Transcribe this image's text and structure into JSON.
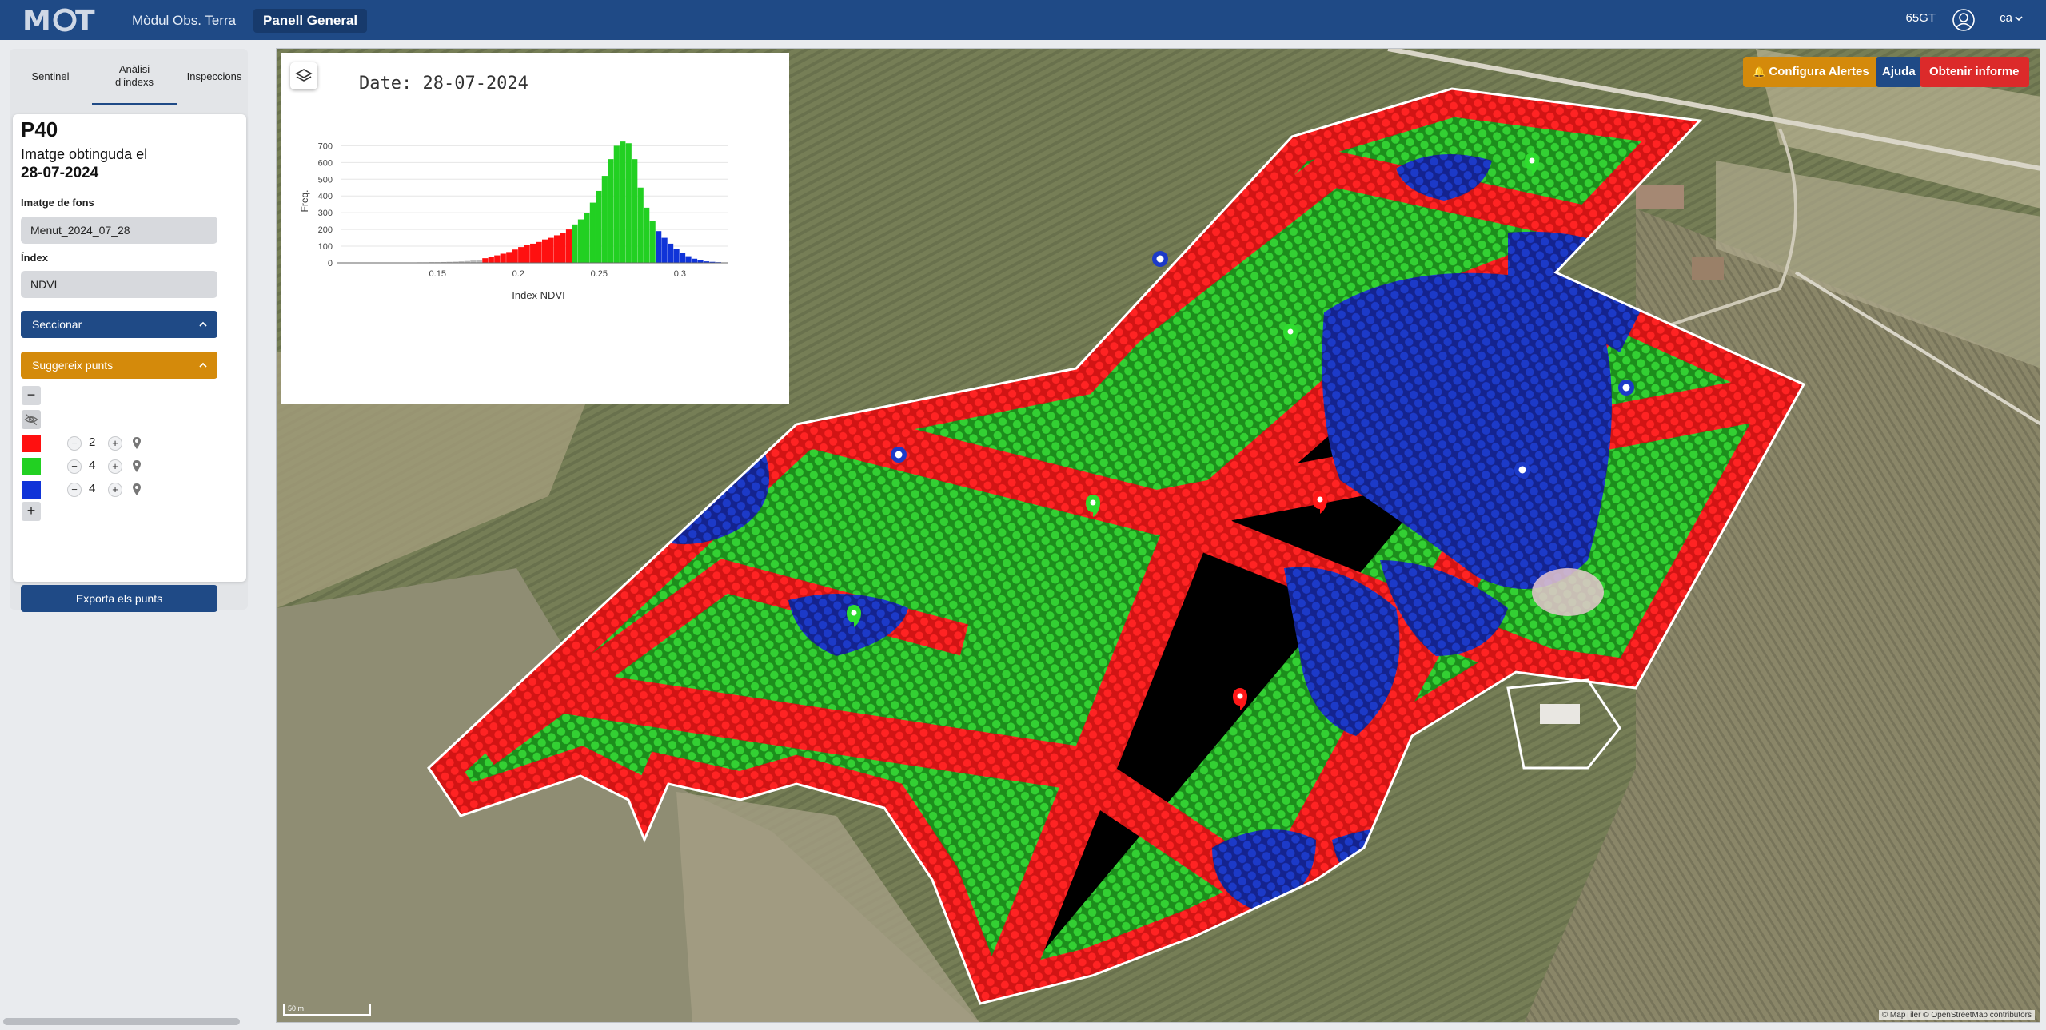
{
  "navbar": {
    "brand": "MOT",
    "links": [
      "Mòdul Obs. Terra",
      "Panell General"
    ],
    "active_link": "Panell General",
    "user": "65GT",
    "lang": "ca",
    "icons": [
      "user-circle-icon",
      "chevron-down-icon"
    ]
  },
  "sidebar": {
    "tabs": [
      "Sentinel",
      "Anàlisi d'índexs",
      "Inspeccions"
    ],
    "active_tab": "Anàlisi d'índexs",
    "card": {
      "title": "P40",
      "subtitle": "Imatge obtinguda el",
      "date": "28-07-2024",
      "background_label": "Imatge de fons",
      "background_value": "Menut_2024_07_28",
      "index_label": "Índex",
      "index_value": "NDVI",
      "section_button": "Seccionar",
      "suggest_button": "Suggereix punts",
      "points": [
        {
          "color": "#ff1010",
          "count": "2"
        },
        {
          "color": "#22d022",
          "count": "4"
        },
        {
          "color": "#1034d8",
          "count": "4"
        }
      ],
      "remove_label": "−",
      "add_label": "+",
      "minus_label": "−",
      "plus_label": "+",
      "export_button": "Exporta els punts"
    }
  },
  "map": {
    "buttons": {
      "alert": "Configura Alertes",
      "help": "Ajuda",
      "report": "Obtenir informe"
    },
    "scale": "50 m",
    "attribution": "© MapTiler © OpenStreetMap contributors",
    "colors": {
      "red": "#ee1a1a",
      "green": "#2cc92c",
      "blue": "#1431b8"
    }
  },
  "chart_data": {
    "type": "bar",
    "title": "Date: 28-07-2024",
    "xlabel": "Index NDVI",
    "ylabel": "Freq.",
    "xlim": [
      0.09,
      0.33
    ],
    "ylim": [
      0,
      740
    ],
    "xticks": [
      "0.15",
      "0.2",
      "0.25",
      "0.3"
    ],
    "yticks": [
      "0",
      "100",
      "200",
      "300",
      "400",
      "500",
      "600",
      "700"
    ],
    "bin_width": 0.0037,
    "bins": [
      {
        "x": 0.1,
        "v": 1,
        "c": "#bbbbbb"
      },
      {
        "x": 0.1037,
        "v": 1,
        "c": "#bbbbbb"
      },
      {
        "x": 0.1074,
        "v": 1,
        "c": "#bbbbbb"
      },
      {
        "x": 0.1111,
        "v": 1,
        "c": "#bbbbbb"
      },
      {
        "x": 0.1148,
        "v": 1,
        "c": "#bbbbbb"
      },
      {
        "x": 0.1185,
        "v": 1,
        "c": "#bbbbbb"
      },
      {
        "x": 0.1222,
        "v": 2,
        "c": "#bbbbbb"
      },
      {
        "x": 0.1259,
        "v": 2,
        "c": "#bbbbbb"
      },
      {
        "x": 0.1296,
        "v": 2,
        "c": "#bbbbbb"
      },
      {
        "x": 0.1333,
        "v": 2,
        "c": "#bbbbbb"
      },
      {
        "x": 0.137,
        "v": 3,
        "c": "#bbbbbb"
      },
      {
        "x": 0.1407,
        "v": 3,
        "c": "#bbbbbb"
      },
      {
        "x": 0.1444,
        "v": 4,
        "c": "#bbbbbb"
      },
      {
        "x": 0.1481,
        "v": 4,
        "c": "#bbbbbb"
      },
      {
        "x": 0.1518,
        "v": 5,
        "c": "#bbbbbb"
      },
      {
        "x": 0.1555,
        "v": 6,
        "c": "#bbbbbb"
      },
      {
        "x": 0.1592,
        "v": 7,
        "c": "#bbbbbb"
      },
      {
        "x": 0.1629,
        "v": 9,
        "c": "#bbbbbb"
      },
      {
        "x": 0.1666,
        "v": 11,
        "c": "#bbbbbb"
      },
      {
        "x": 0.1703,
        "v": 14,
        "c": "#bbbbbb"
      },
      {
        "x": 0.174,
        "v": 18,
        "c": "#bbbbbb"
      },
      {
        "x": 0.1777,
        "v": 28,
        "c": "#ff1010"
      },
      {
        "x": 0.1814,
        "v": 35,
        "c": "#ff1010"
      },
      {
        "x": 0.1851,
        "v": 45,
        "c": "#ff1010"
      },
      {
        "x": 0.1888,
        "v": 55,
        "c": "#ff1010"
      },
      {
        "x": 0.1925,
        "v": 65,
        "c": "#ff1010"
      },
      {
        "x": 0.1962,
        "v": 80,
        "c": "#ff1010"
      },
      {
        "x": 0.1999,
        "v": 95,
        "c": "#ff1010"
      },
      {
        "x": 0.2036,
        "v": 105,
        "c": "#ff1010"
      },
      {
        "x": 0.2073,
        "v": 115,
        "c": "#ff1010"
      },
      {
        "x": 0.211,
        "v": 125,
        "c": "#ff1010"
      },
      {
        "x": 0.2147,
        "v": 140,
        "c": "#ff1010"
      },
      {
        "x": 0.2184,
        "v": 150,
        "c": "#ff1010"
      },
      {
        "x": 0.2221,
        "v": 165,
        "c": "#ff1010"
      },
      {
        "x": 0.2258,
        "v": 180,
        "c": "#ff1010"
      },
      {
        "x": 0.2295,
        "v": 200,
        "c": "#ff1010"
      },
      {
        "x": 0.2332,
        "v": 230,
        "c": "#22d022"
      },
      {
        "x": 0.2369,
        "v": 260,
        "c": "#22d022"
      },
      {
        "x": 0.2406,
        "v": 300,
        "c": "#22d022"
      },
      {
        "x": 0.2443,
        "v": 360,
        "c": "#22d022"
      },
      {
        "x": 0.248,
        "v": 430,
        "c": "#22d022"
      },
      {
        "x": 0.2517,
        "v": 520,
        "c": "#22d022"
      },
      {
        "x": 0.2554,
        "v": 620,
        "c": "#22d022"
      },
      {
        "x": 0.2591,
        "v": 700,
        "c": "#22d022"
      },
      {
        "x": 0.2628,
        "v": 725,
        "c": "#22d022"
      },
      {
        "x": 0.2665,
        "v": 715,
        "c": "#22d022"
      },
      {
        "x": 0.2702,
        "v": 620,
        "c": "#22d022"
      },
      {
        "x": 0.2739,
        "v": 450,
        "c": "#22d022"
      },
      {
        "x": 0.2776,
        "v": 330,
        "c": "#22d022"
      },
      {
        "x": 0.2813,
        "v": 250,
        "c": "#22d022"
      },
      {
        "x": 0.285,
        "v": 190,
        "c": "#1034d8"
      },
      {
        "x": 0.2887,
        "v": 150,
        "c": "#1034d8"
      },
      {
        "x": 0.2924,
        "v": 115,
        "c": "#1034d8"
      },
      {
        "x": 0.2961,
        "v": 85,
        "c": "#1034d8"
      },
      {
        "x": 0.2998,
        "v": 60,
        "c": "#1034d8"
      },
      {
        "x": 0.3035,
        "v": 40,
        "c": "#1034d8"
      },
      {
        "x": 0.3072,
        "v": 25,
        "c": "#1034d8"
      },
      {
        "x": 0.3109,
        "v": 15,
        "c": "#1034d8"
      },
      {
        "x": 0.3146,
        "v": 9,
        "c": "#1034d8"
      },
      {
        "x": 0.3183,
        "v": 6,
        "c": "#1034d8"
      },
      {
        "x": 0.322,
        "v": 4,
        "c": "#1034d8"
      },
      {
        "x": 0.3257,
        "v": 2,
        "c": "#1034d8"
      }
    ]
  }
}
